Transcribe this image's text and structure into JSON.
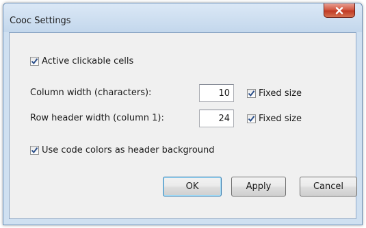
{
  "window": {
    "title": "Cooc Settings",
    "close_icon": "close-icon"
  },
  "options": {
    "active_clickable_cells": {
      "label": "Active clickable cells",
      "checked": true
    },
    "column_width": {
      "label": "Column width (characters):",
      "value": "10",
      "fixed_size": {
        "label": "Fixed size",
        "checked": true
      }
    },
    "row_header_width": {
      "label": "Row header width (column 1):",
      "value": "24",
      "fixed_size": {
        "label": "Fixed size",
        "checked": true
      }
    },
    "use_code_colors": {
      "label": "Use code colors as header background",
      "checked": true
    }
  },
  "buttons": {
    "ok": "OK",
    "apply": "Apply",
    "cancel": "Cancel"
  },
  "colors": {
    "frame": "#cfe0f1",
    "close_button": "#c8452e",
    "check_mark": "#2b4f8a",
    "client_background": "#f0f0f0"
  }
}
